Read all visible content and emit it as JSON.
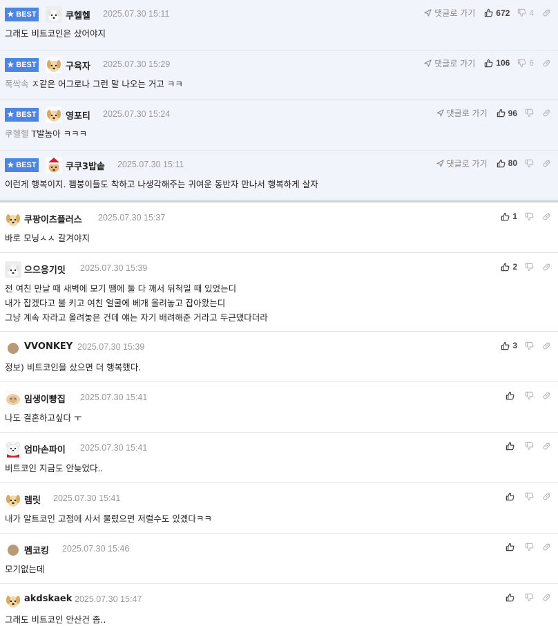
{
  "best_badge": "BEST",
  "reply_label": "댓글로 가기",
  "best_comments": [
    {
      "user": "쿠헬헬",
      "date": "2025.07.30 15:11",
      "avatar": "dog-white",
      "mention": "",
      "text": "그래도 비트코인은 샀어야지",
      "up": "672",
      "down": "4"
    },
    {
      "user": "구육자",
      "date": "2025.07.30 15:29",
      "avatar": "dog-yellow",
      "mention": "폭싹속",
      "text": "ㅈ같은 어그로나 그런 말 나오는 거고 ㅋㅋ",
      "up": "106",
      "down": "6"
    },
    {
      "user": "영포티",
      "date": "2025.07.30 15:24",
      "avatar": "dog-yellow",
      "mention": "쿠헬헬",
      "text": "T발놈아 ㅋㅋㅋ",
      "up": "96",
      "down": ""
    },
    {
      "user": "쿠쿠3밥솥",
      "date": "2025.07.30 15:11",
      "avatar": "dog-santa",
      "mention": "",
      "text": "이런게 행복이지. 펨붕이들도 착하고 나생각해주는 귀여운 동반자 만나서 행복하게 살자",
      "up": "80",
      "down": ""
    }
  ],
  "comments": [
    {
      "user": "쿠팡이츠플러스",
      "date": "2025.07.30 15:37",
      "avatar": "dog-yellow",
      "lines": [
        "바로 모닝ㅅㅅ 갈겨야지"
      ],
      "up": "1"
    },
    {
      "user": "으으응기잇",
      "date": "2025.07.30 15:39",
      "avatar": "dog-white",
      "lines": [
        "전 여친 만날 때 새벽에 모기 땜에 둘 다 깨서 뒤척일 때 있었는디",
        "내가 잡겠다고 불 키고 여친 얼굴에 베개 올려놓고 잡아왔는디",
        "그냥 계속 자라고 올려놓은 건데 얘는 자기 배려해준 거라고 두근댔다더라"
      ],
      "up": "2"
    },
    {
      "user": "VVONKEY",
      "date": "2025.07.30 15:39",
      "avatar": "dot",
      "lines": [
        "정보) 비트코인을 샀으면 더 행복했다."
      ],
      "up": "3"
    },
    {
      "user": "임생이빵집",
      "date": "2025.07.30 15:41",
      "avatar": "dog-blur",
      "lines": [
        "나도 결혼하고싶다 ㅜ"
      ],
      "up": ""
    },
    {
      "user": "엄마손파이",
      "date": "2025.07.30 15:41",
      "avatar": "bear",
      "lines": [
        "비트코인 지금도 안늦었다.."
      ],
      "up": ""
    },
    {
      "user": "렘릿",
      "date": "2025.07.30 15:41",
      "avatar": "dog-yellow",
      "lines": [
        "내가 알트코인 고점에 사서 물렸으면 저럴수도 있겠다ㅋㅋ"
      ],
      "up": ""
    },
    {
      "user": "펨코킹",
      "date": "2025.07.30 15:46",
      "avatar": "dot",
      "lines": [
        "모기없는데"
      ],
      "up": ""
    },
    {
      "user": "akdskaek",
      "date": "2025.07.30 15:47",
      "avatar": "dog-yellow",
      "lines": [
        "그래도 비트코인 안산건 좀.."
      ],
      "up": ""
    }
  ],
  "colors": {
    "best_badge": "#4d86e0",
    "best_bg": "#f1f4fb",
    "meta": "#999999",
    "mention": "#999999"
  }
}
